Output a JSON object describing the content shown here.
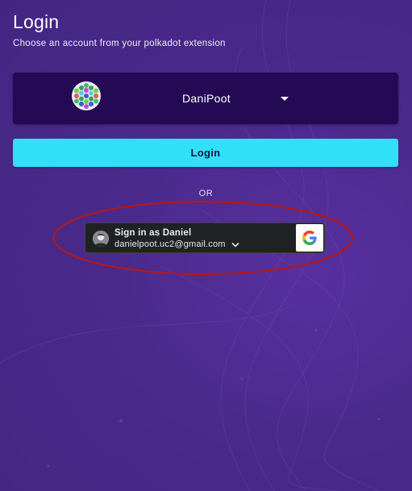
{
  "page": {
    "title": "Login",
    "subtitle": "Choose an account from your polkadot extension"
  },
  "account_selector": {
    "selected_account": "DaniPoot",
    "avatar_icon": "polkadot-identicon-icon",
    "dropdown_icon": "caret-down-icon"
  },
  "login_button": {
    "label": "Login"
  },
  "divider": {
    "label": "OR"
  },
  "google_signin": {
    "label": "Sign in as Daniel",
    "email": "danielpoot.uc2@gmail.com",
    "dropdown_icon": "chevron-down-icon",
    "brand_icon": "google-g-icon"
  },
  "annotation": {
    "shape": "ellipse",
    "color": "#b31818"
  },
  "colors": {
    "background": "#4a2a8c",
    "account_box": "#240a55",
    "login_button": "#2fe0f8",
    "google_button": "#202124"
  }
}
